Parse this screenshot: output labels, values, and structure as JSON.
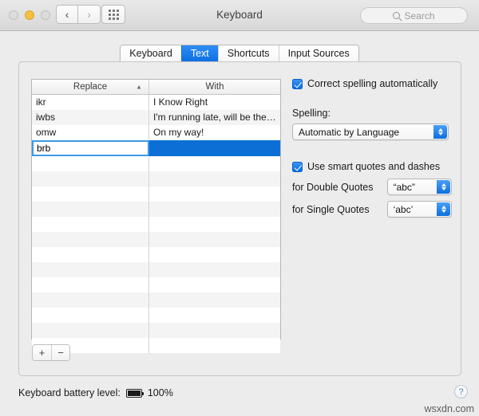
{
  "window": {
    "title": "Keyboard",
    "traffic_lights": [
      "close",
      "minimize",
      "zoom"
    ],
    "nav_back_icon": "chevron-left-icon",
    "nav_forward_icon": "chevron-right-icon",
    "show_all_icon": "grid-icon"
  },
  "search": {
    "placeholder": "Search",
    "value": "",
    "icon": "search-icon"
  },
  "tabs": [
    {
      "label": "Keyboard",
      "selected": false
    },
    {
      "label": "Text",
      "selected": true
    },
    {
      "label": "Shortcuts",
      "selected": false
    },
    {
      "label": "Input Sources",
      "selected": false
    }
  ],
  "table": {
    "columns": [
      {
        "label": "Replace",
        "sorted": true,
        "sort_icon": "caret-up-icon"
      },
      {
        "label": "With",
        "sorted": false
      }
    ],
    "rows": [
      {
        "replace": "ikr",
        "with": "I Know Right"
      },
      {
        "replace": "iwbs",
        "with": "I'm running late, will be the…"
      },
      {
        "replace": "omw",
        "with": "On my way!"
      }
    ],
    "editing_row": {
      "replace_value": "brb",
      "with_value": "",
      "selected": true
    },
    "empty_row_count": 13
  },
  "buttons": {
    "add_label": "+",
    "remove_label": "−"
  },
  "settings": {
    "correct_spelling": {
      "label": "Correct spelling automatically",
      "checked": true
    },
    "spelling": {
      "label": "Spelling:",
      "selected_option": "Automatic by Language",
      "options": [
        "Automatic by Language"
      ]
    },
    "smart_quotes": {
      "label": "Use smart quotes and dashes",
      "checked": true
    },
    "double_quotes": {
      "label": "for Double Quotes",
      "selected_option": "“abc”"
    },
    "single_quotes": {
      "label": "for Single Quotes",
      "selected_option": "‘abc’"
    }
  },
  "status": {
    "battery_label": "Keyboard battery level:",
    "battery_icon": "battery-full-icon",
    "battery_percent": "100%"
  },
  "help": {
    "label": "?"
  },
  "watermark": {
    "text": "wsxdn.com"
  },
  "colors": {
    "accent_blue": "#0b6fd6",
    "tab_selected": "#1a7ceb",
    "window_bg": "#ececec",
    "yellow_light": "#f6bf3f"
  }
}
